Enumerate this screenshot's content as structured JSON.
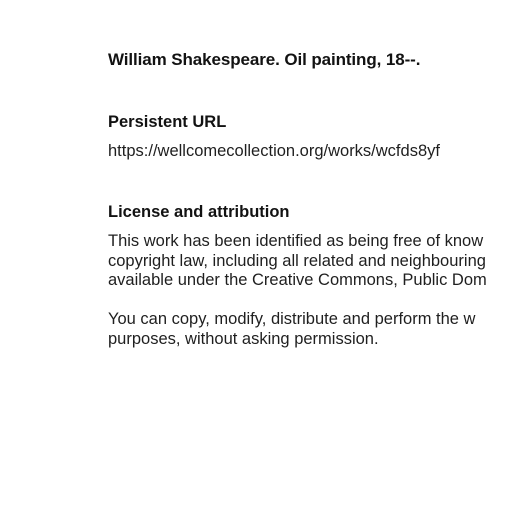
{
  "work": {
    "title": "William Shakespeare. Oil painting, 18--."
  },
  "persistent_url": {
    "heading": "Persistent URL",
    "url": "https://wellcomecollection.org/works/wcfds8yf"
  },
  "license": {
    "heading": "License and attribution",
    "paragraph_1": [
      "This work has been identified as being free of know",
      "copyright law, including all related and neighbouring",
      "available under the Creative Commons, Public Dom"
    ],
    "paragraph_2": [
      "You can copy, modify, distribute and perform the w",
      "purposes, without asking permission."
    ]
  }
}
